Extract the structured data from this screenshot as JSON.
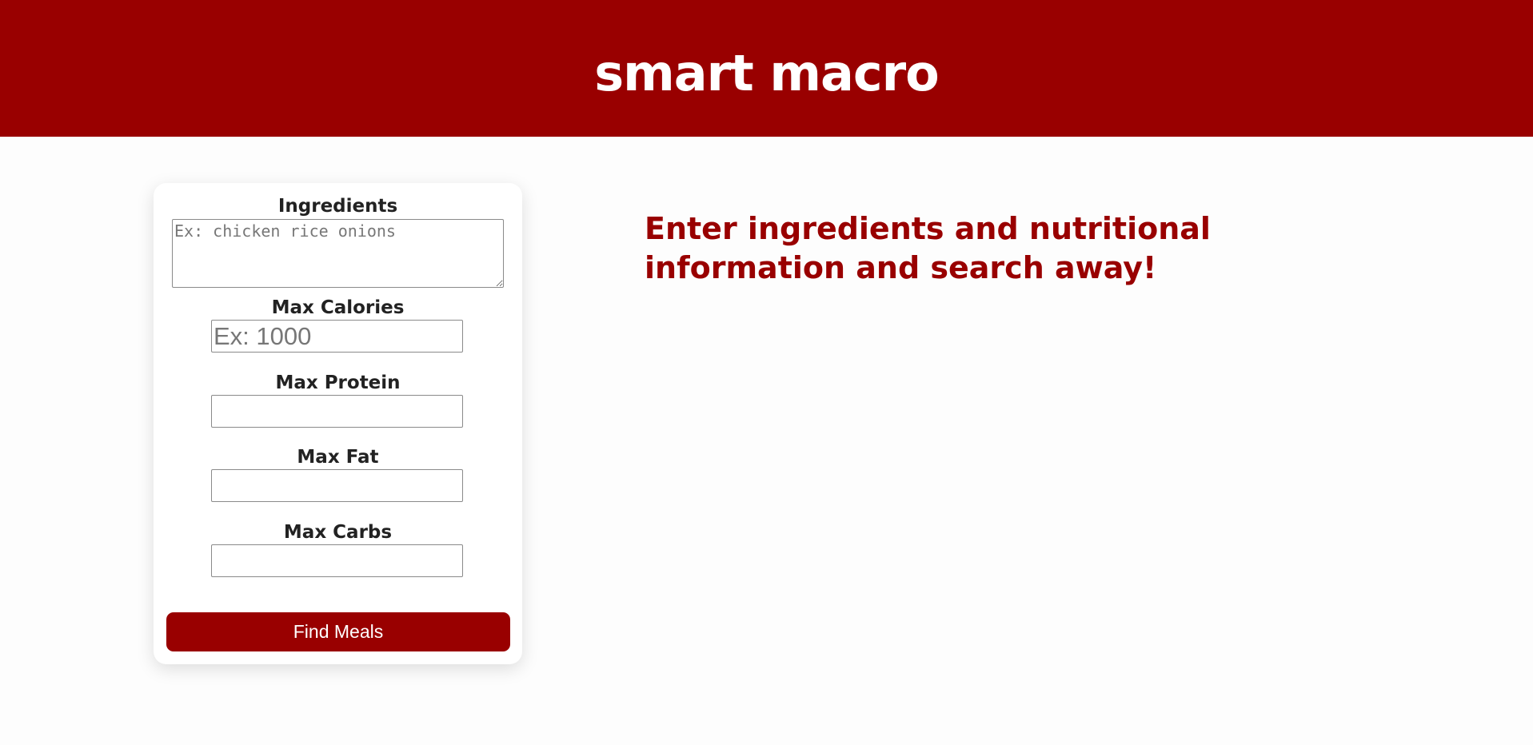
{
  "app": {
    "title": "smart macro"
  },
  "form": {
    "ingredients": {
      "label": "Ingredients",
      "placeholder": "Ex: chicken rice onions",
      "value": ""
    },
    "max_calories": {
      "label": "Max Calories",
      "placeholder": "Ex: 1000",
      "value": ""
    },
    "max_protein": {
      "label": "Max Protein",
      "placeholder": "",
      "value": ""
    },
    "max_fat": {
      "label": "Max Fat",
      "placeholder": "",
      "value": ""
    },
    "max_carbs": {
      "label": "Max Carbs",
      "placeholder": "",
      "value": ""
    },
    "submit_label": "Find Meals"
  },
  "main": {
    "message": "Enter ingredients and nutritional information and search away!"
  },
  "colors": {
    "brand": "#990000",
    "background": "#fdfdfd",
    "card": "#ffffff",
    "label_text": "#222222"
  }
}
